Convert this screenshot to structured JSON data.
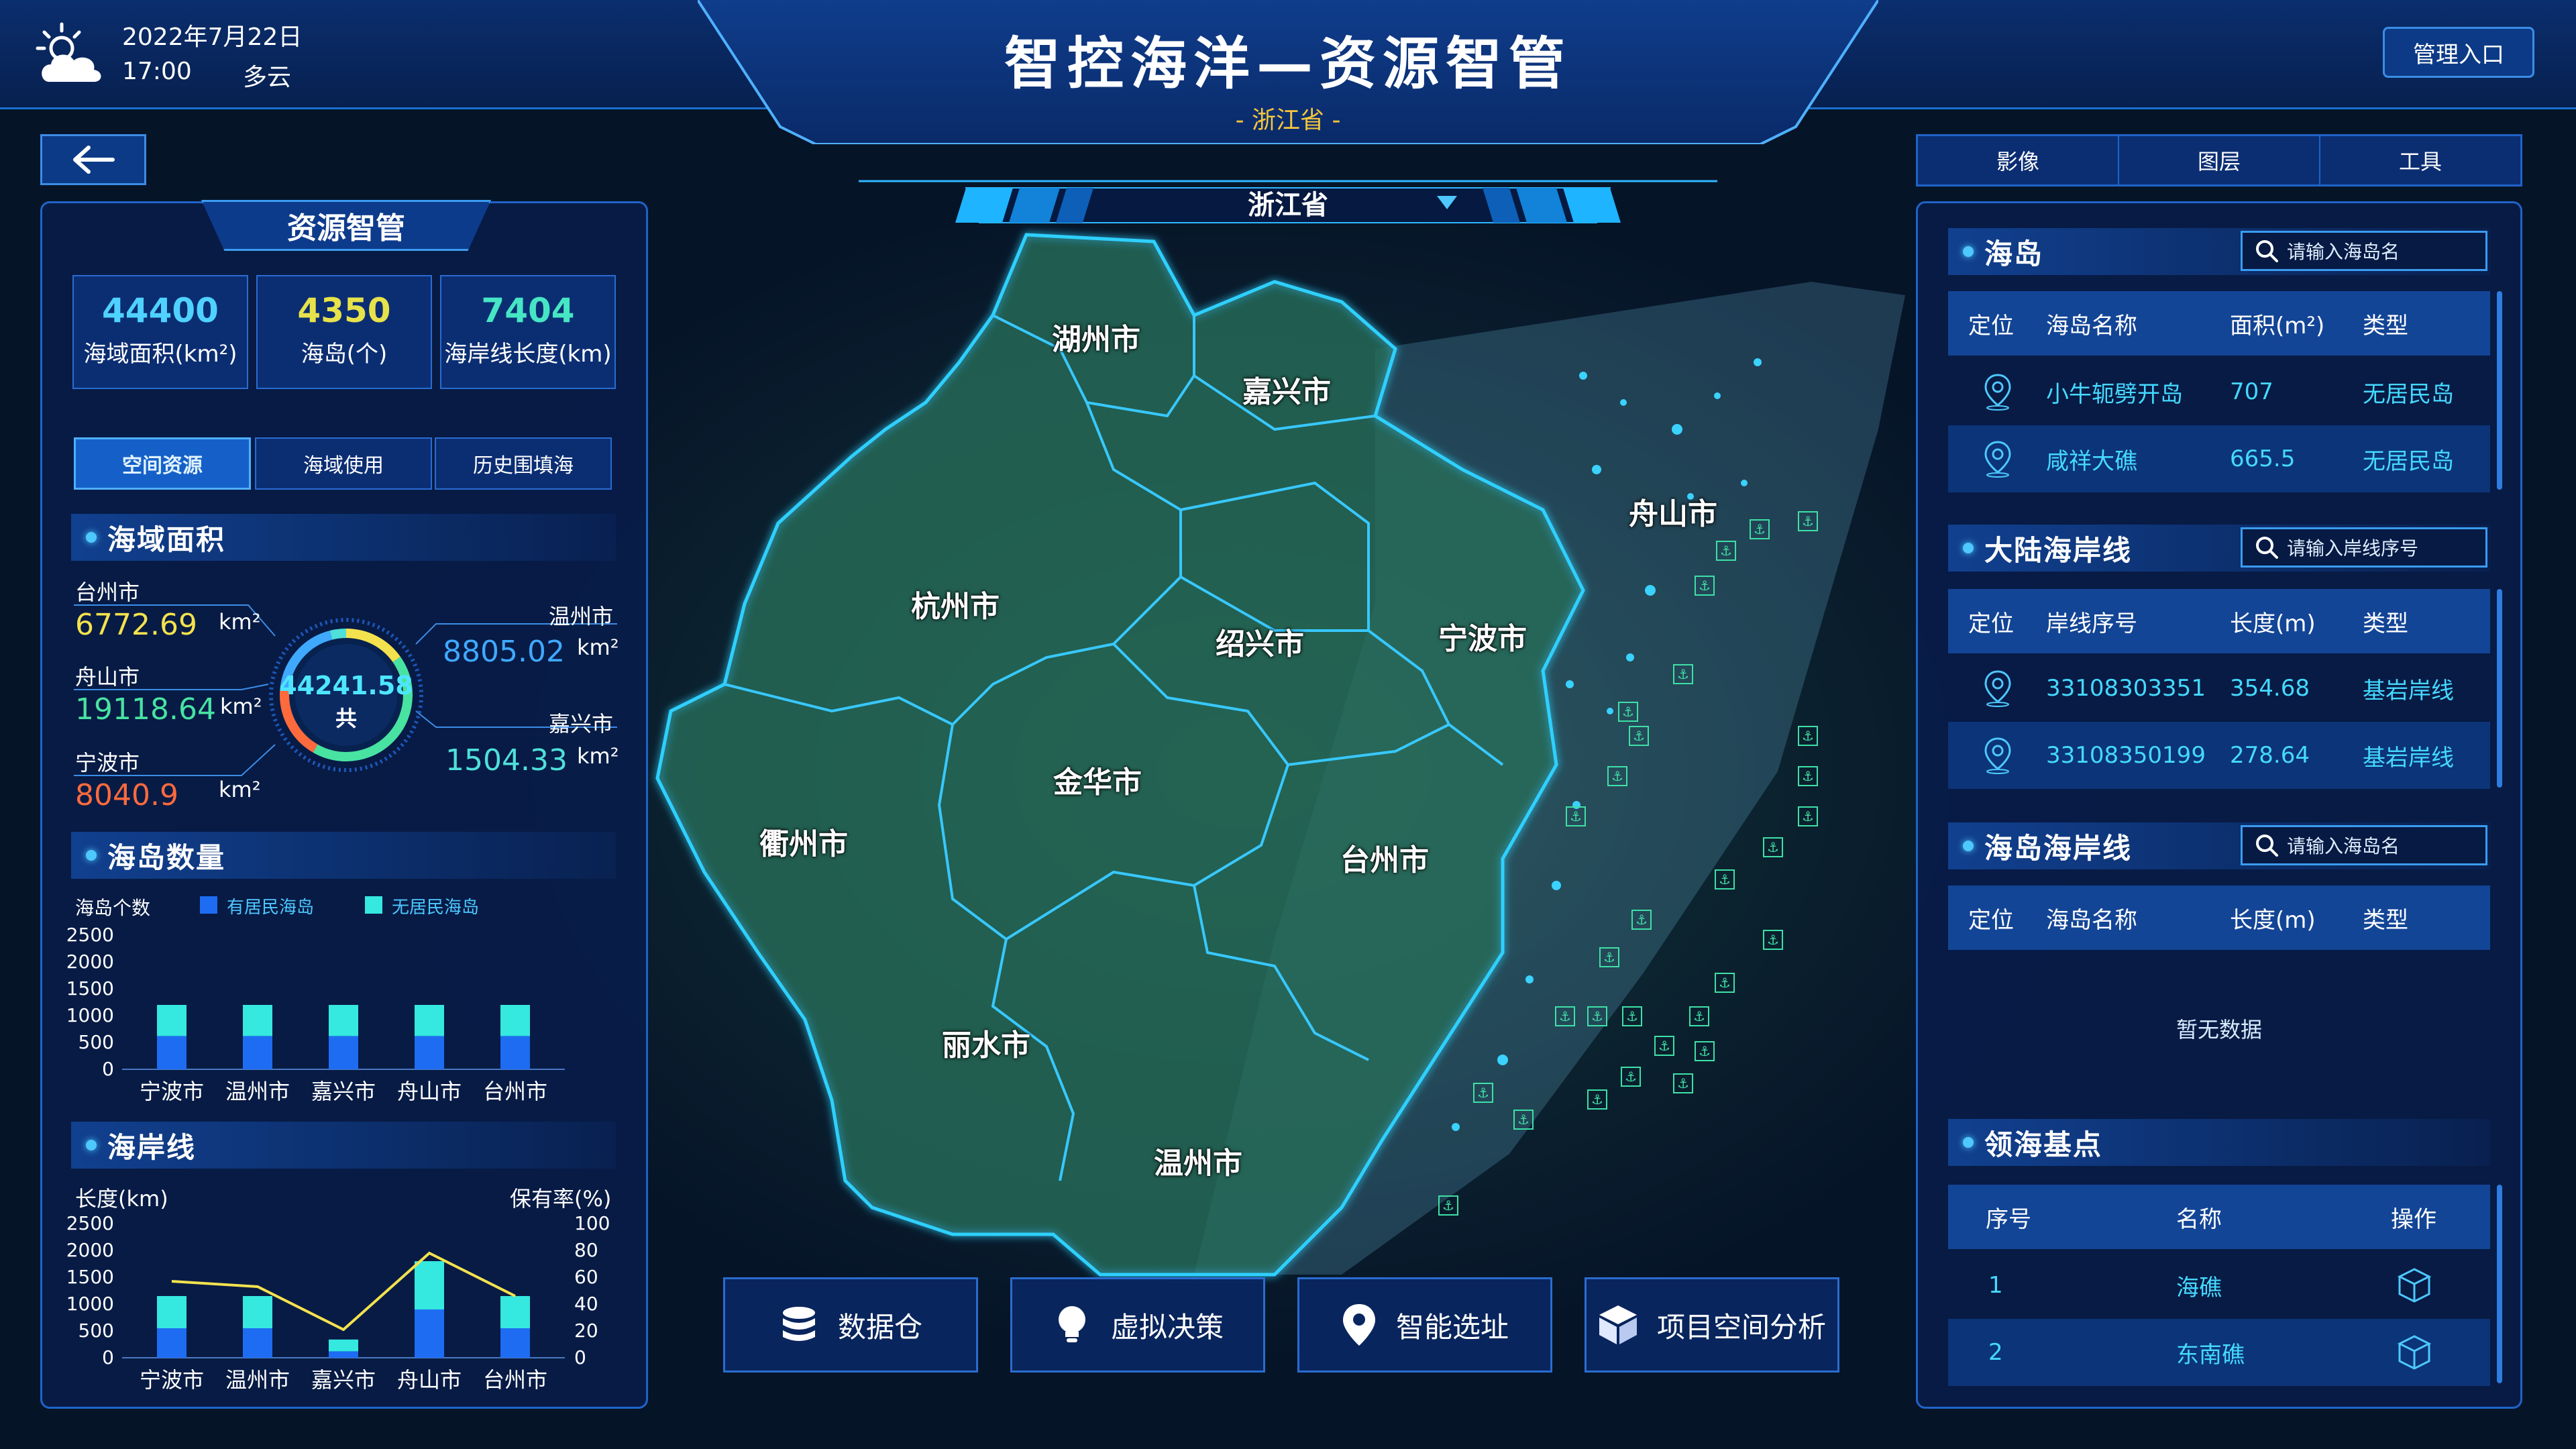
{
  "header": {
    "title": "智控海洋—资源智管",
    "subtitle": "- 浙江省 -",
    "date": "2022年7月22日",
    "time": "17:00",
    "weather": "多云",
    "weather_icon": "cloud-sun-icon",
    "admin_button": "管理入口",
    "back_icon": "arrow-left-icon"
  },
  "left_panel": {
    "title": "资源智管",
    "stats": [
      {
        "value": "44400",
        "label": "海域面积(km²)",
        "color": "#4fd2ff"
      },
      {
        "value": "4350",
        "label": "海岛(个)",
        "color": "#e7e24a"
      },
      {
        "value": "7404",
        "label": "海岸线长度(km)",
        "color": "#46e6c4"
      }
    ],
    "tabs": [
      "空间资源",
      "海域使用",
      "历史围填海"
    ],
    "sea_area": {
      "heading": "海域面积",
      "total_value": "44241.58",
      "total_label": "共",
      "unit": "km²",
      "cities": [
        {
          "name": "台州市",
          "value": "6772.69",
          "color": "#f3e24d"
        },
        {
          "name": "舟山市",
          "value": "19118.64",
          "color": "#48e3a1"
        },
        {
          "name": "宁波市",
          "value": "8040.9",
          "color": "#ff6a3d"
        },
        {
          "name": "温州市",
          "value": "8805.02",
          "color": "#3fa9ff"
        },
        {
          "name": "嘉兴市",
          "value": "1504.33",
          "color": "#4fe0d9"
        }
      ]
    },
    "island_count": {
      "heading": "海岛数量",
      "y_title": "海岛个数",
      "legend_inhabited": "有居民海岛",
      "legend_uninhabited": "无居民海岛"
    },
    "coastline": {
      "heading": "海岸线",
      "y_left_title": "长度(km)",
      "y_right_title": "保有率(%)"
    }
  },
  "chart_data": [
    {
      "type": "bar",
      "title": "海岛数量",
      "ylabel": "海岛个数",
      "categories": [
        "宁波市",
        "温州市",
        "嘉兴市",
        "舟山市",
        "台州市"
      ],
      "ylim": [
        0,
        2500
      ],
      "yticks": [
        "2500",
        "2000",
        "1500",
        "1000",
        "500",
        "0"
      ],
      "stacked": true,
      "series": [
        {
          "name": "有居民海岛",
          "values": [
            620,
            620,
            620,
            620,
            620
          ],
          "color": "#1d6cf2"
        },
        {
          "name": "无居民海岛",
          "values": [
            580,
            580,
            580,
            580,
            580
          ],
          "color": "#35e8e0"
        }
      ]
    },
    {
      "type": "bar",
      "title": "海岸线",
      "ylabel": "长度(km)",
      "y2label": "保有率(%)",
      "categories": [
        "宁波市",
        "温州市",
        "嘉兴市",
        "舟山市",
        "台州市"
      ],
      "ylim": [
        0,
        2500
      ],
      "y2lim": [
        0,
        100
      ],
      "yticks": [
        "2500",
        "2000",
        "1500",
        "1000",
        "500",
        "0"
      ],
      "y2ticks": [
        "100",
        "80",
        "60",
        "40",
        "20",
        "0"
      ],
      "stacked": true,
      "series": [
        {
          "name": "",
          "values": [
            550,
            550,
            120,
            900,
            550
          ],
          "color": "#1d6cf2"
        },
        {
          "name": "",
          "values": [
            600,
            600,
            220,
            900,
            600
          ],
          "color": "#35e8e0"
        },
        {
          "name": "保有率",
          "type": "line",
          "axis": "right",
          "values": [
            57,
            53,
            21,
            78,
            46
          ],
          "color": "#f3e24d"
        }
      ]
    }
  ],
  "map": {
    "province_selector": "浙江省",
    "cities": [
      "湖州市",
      "嘉兴市",
      "杭州市",
      "绍兴市",
      "宁波市",
      "舟山市",
      "衢州市",
      "金华市",
      "台州市",
      "丽水市",
      "温州市"
    ],
    "bottom_buttons": [
      {
        "label": "数据仓",
        "icon": "database-icon"
      },
      {
        "label": "虚拟决策",
        "icon": "lightbulb-icon"
      },
      {
        "label": "智能选址",
        "icon": "location-pin-icon"
      },
      {
        "label": "项目空间分析",
        "icon": "cube-icon"
      }
    ]
  },
  "right_panel": {
    "tabs": [
      "影像",
      "图层",
      "工具"
    ],
    "islands": {
      "heading": "海岛",
      "search_placeholder": "请输入海岛名",
      "columns": [
        "定位",
        "海岛名称",
        "面积(m²)",
        "类型"
      ],
      "rows": [
        {
          "name": "小牛轭劈开岛",
          "area": "707",
          "type": "无居民岛"
        },
        {
          "name": "咸祥大礁",
          "area": "665.5",
          "type": "无居民岛"
        }
      ]
    },
    "mainland_coast": {
      "heading": "大陆海岸线",
      "search_placeholder": "请输入岸线序号",
      "columns": [
        "定位",
        "岸线序号",
        "长度(m)",
        "类型"
      ],
      "rows": [
        {
          "id": "33108303351",
          "length": "354.68",
          "type": "基岩岸线"
        },
        {
          "id": "33108350199",
          "length": "278.64",
          "type": "基岩岸线"
        }
      ]
    },
    "island_coast": {
      "heading": "海岛海岸线",
      "search_placeholder": "请输入海岛名",
      "columns": [
        "定位",
        "海岛名称",
        "长度(m)",
        "类型"
      ],
      "empty_text": "暂无数据"
    },
    "baseline": {
      "heading": "领海基点",
      "columns": [
        "序号",
        "名称",
        "操作"
      ],
      "rows": [
        {
          "no": "1",
          "name": "海礁"
        },
        {
          "no": "2",
          "name": "东南礁"
        }
      ]
    }
  }
}
